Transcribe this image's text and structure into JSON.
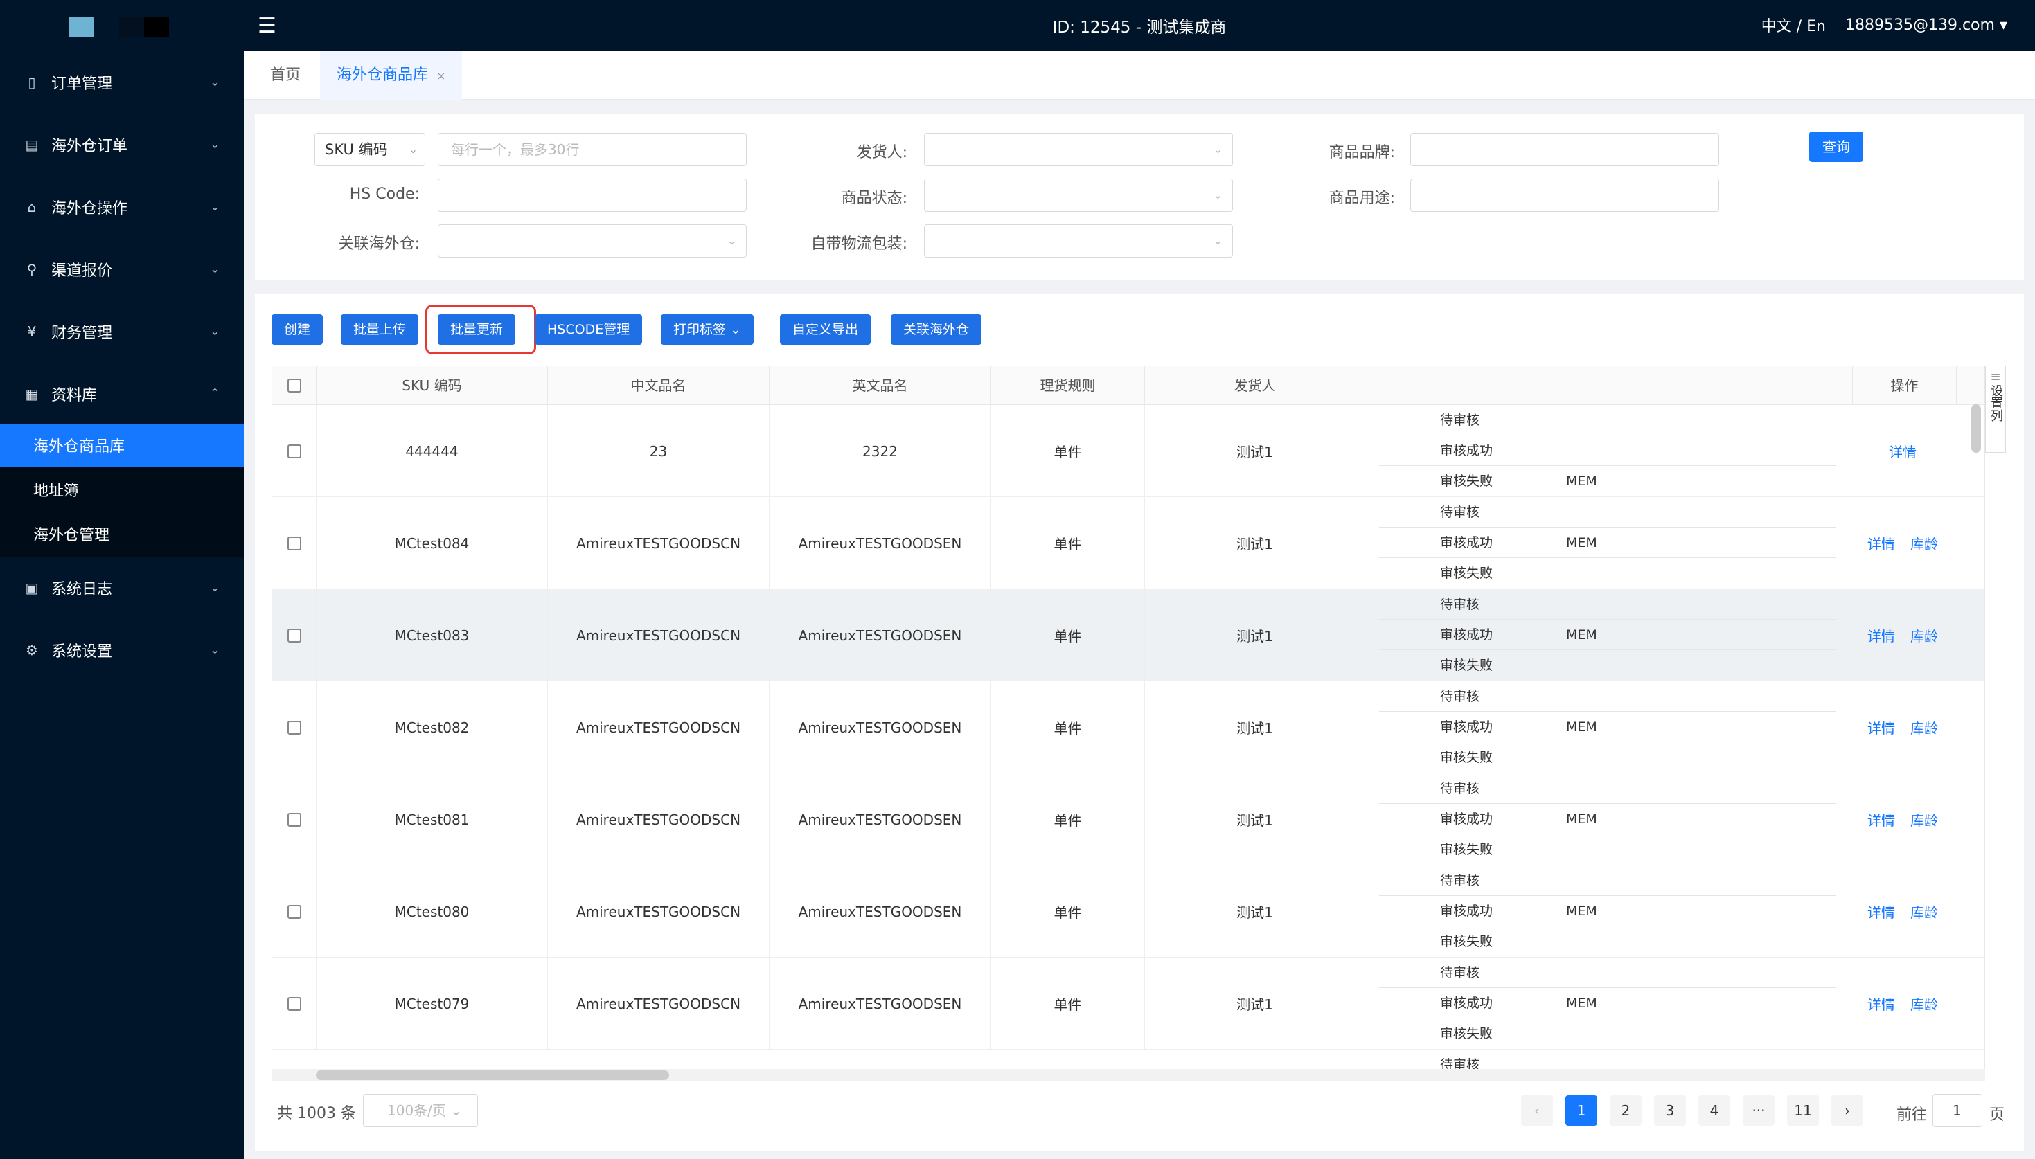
{
  "topbar": {
    "title": "ID: 12545 - 测试集成商",
    "lang": "中文 / En",
    "user": "1889535@139.com"
  },
  "sidebar": {
    "items": [
      {
        "label": "订单管理",
        "icon": "order-icon"
      },
      {
        "label": "海外仓订单",
        "icon": "receipt-icon"
      },
      {
        "label": "海外仓操作",
        "icon": "home-icon"
      },
      {
        "label": "渠道报价",
        "icon": "network-icon"
      },
      {
        "label": "财务管理",
        "icon": "yen-icon"
      },
      {
        "label": "资料库",
        "icon": "grid-icon"
      },
      {
        "label": "系统日志",
        "icon": "log-icon"
      },
      {
        "label": "系统设置",
        "icon": "gear-icon"
      }
    ],
    "subitems": [
      {
        "label": "海外仓商品库"
      },
      {
        "label": "地址簿"
      },
      {
        "label": "海外仓管理"
      }
    ]
  },
  "tabs": {
    "home": "首页",
    "current": "海外仓商品库",
    "close": "×"
  },
  "filters": {
    "sku_select": "SKU 编码",
    "sku_placeholder": "每行一个，最多30行",
    "hs_label": "HS Code:",
    "warehouse_label": "关联海外仓:",
    "shipper_label": "发货人:",
    "status_label": "商品状态:",
    "packaging_label": "自带物流包装:",
    "brand_label": "商品品牌:",
    "usage_label": "商品用途:",
    "query_button": "查询"
  },
  "toolbar": {
    "create": "创建",
    "batch_upload": "批量上传",
    "batch_update": "批量更新",
    "hscode": "HSCODE管理",
    "print_label": "打印标签",
    "custom_export": "自定义导出",
    "link_warehouse": "关联海外仓"
  },
  "table": {
    "headers": {
      "sku": "SKU 编码",
      "cn_name": "中文品名",
      "en_name": "英文品名",
      "rule": "理货规则",
      "shipper": "发货人",
      "ops": "操作"
    },
    "settings_label": "设置列",
    "status_labels": {
      "pending": "待审核",
      "success": "审核成功",
      "failed": "审核失败"
    },
    "mem": "MEM",
    "op_detail": "详情",
    "op_age": "库龄",
    "rows": [
      {
        "sku": "444444",
        "cn": "23",
        "en": "2322",
        "rule": "单件",
        "shipper": "测试1"
      },
      {
        "sku": "MCtest084",
        "cn": "AmireuxTESTGOODSCN",
        "en": "AmireuxTESTGOODSEN",
        "rule": "单件",
        "shipper": "测试1"
      },
      {
        "sku": "MCtest083",
        "cn": "AmireuxTESTGOODSCN",
        "en": "AmireuxTESTGOODSEN",
        "rule": "单件",
        "shipper": "测试1"
      },
      {
        "sku": "MCtest082",
        "cn": "AmireuxTESTGOODSCN",
        "en": "AmireuxTESTGOODSEN",
        "rule": "单件",
        "shipper": "测试1"
      },
      {
        "sku": "MCtest081",
        "cn": "AmireuxTESTGOODSCN",
        "en": "AmireuxTESTGOODSEN",
        "rule": "单件",
        "shipper": "测试1"
      },
      {
        "sku": "MCtest080",
        "cn": "AmireuxTESTGOODSCN",
        "en": "AmireuxTESTGOODSEN",
        "rule": "单件",
        "shipper": "测试1"
      },
      {
        "sku": "MCtest079",
        "cn": "AmireuxTESTGOODSCN",
        "en": "AmireuxTESTGOODSEN",
        "rule": "单件",
        "shipper": "测试1"
      }
    ],
    "last_partial_status": "待审核"
  },
  "pagination": {
    "total": "共 1003 条",
    "page_size": "100条/页",
    "pages": [
      "1",
      "2",
      "3",
      "4",
      "···",
      "11"
    ],
    "current": "1",
    "goto_label": "前往",
    "goto_value": "1",
    "suffix": "页"
  },
  "colors": {
    "primary": "#1677ff",
    "sidebar": "#001529",
    "highlight": "#e53935"
  }
}
